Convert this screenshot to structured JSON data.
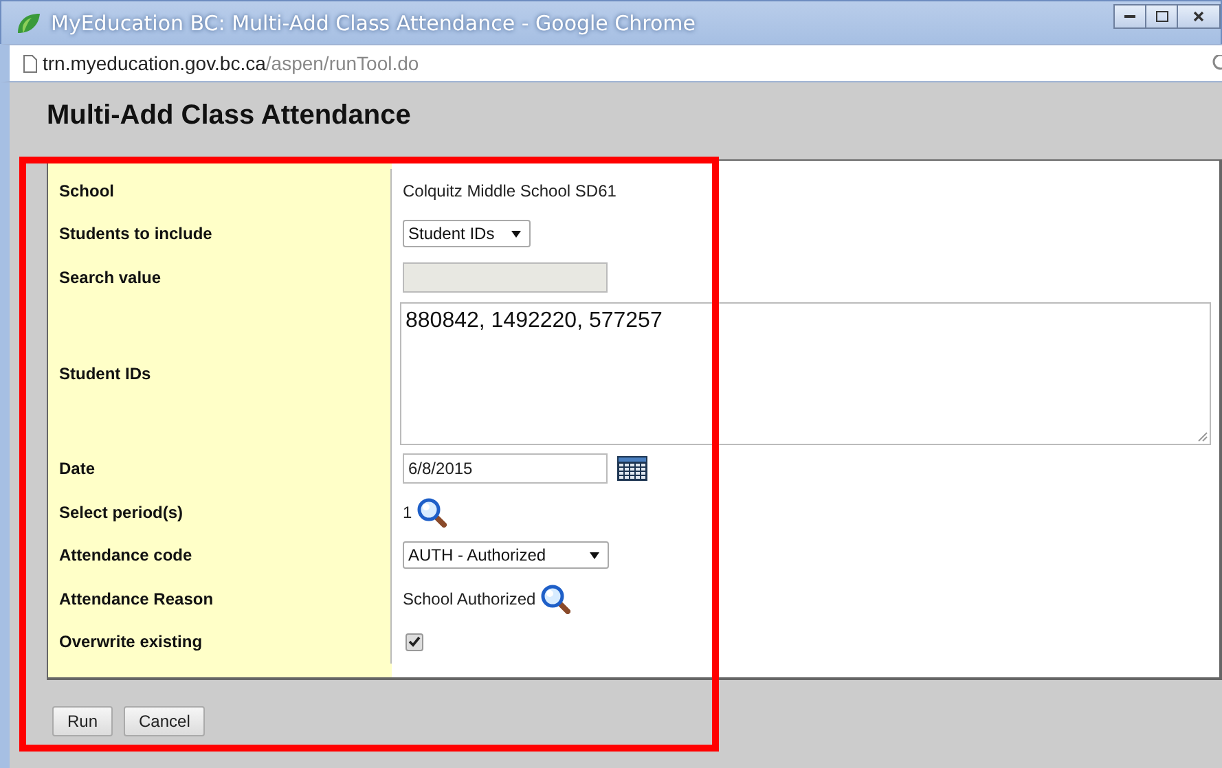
{
  "window": {
    "title": "MyEducation BC: Multi-Add Class Attendance - Google Chrome"
  },
  "address_bar": {
    "host": "trn.myeducation.gov.bc.ca",
    "path": "/aspen/runTool.do"
  },
  "page": {
    "heading": "Multi-Add Class Attendance"
  },
  "form": {
    "rows": [
      {
        "label": "School",
        "kind": "text",
        "value": "Colquitz Middle School SD61"
      },
      {
        "label": "Students to include",
        "kind": "select",
        "value": "Student IDs"
      },
      {
        "label": "Search value",
        "kind": "input",
        "disabled": true
      },
      {
        "label": "Student IDs",
        "kind": "textarea",
        "value": "880842, 1492220, 577257"
      },
      {
        "label": "Date",
        "kind": "date",
        "value": "6/8/2015"
      },
      {
        "label": "Select period(s)",
        "kind": "lookup",
        "value": "1"
      },
      {
        "label": "Attendance code",
        "kind": "select",
        "value": "AUTH - Authorized"
      },
      {
        "label": "Attendance Reason",
        "kind": "lookup",
        "value": "School Authorized"
      },
      {
        "label": "Overwrite existing",
        "kind": "checkbox",
        "checked": true
      }
    ]
  },
  "buttons": [
    "Run",
    "Cancel"
  ]
}
